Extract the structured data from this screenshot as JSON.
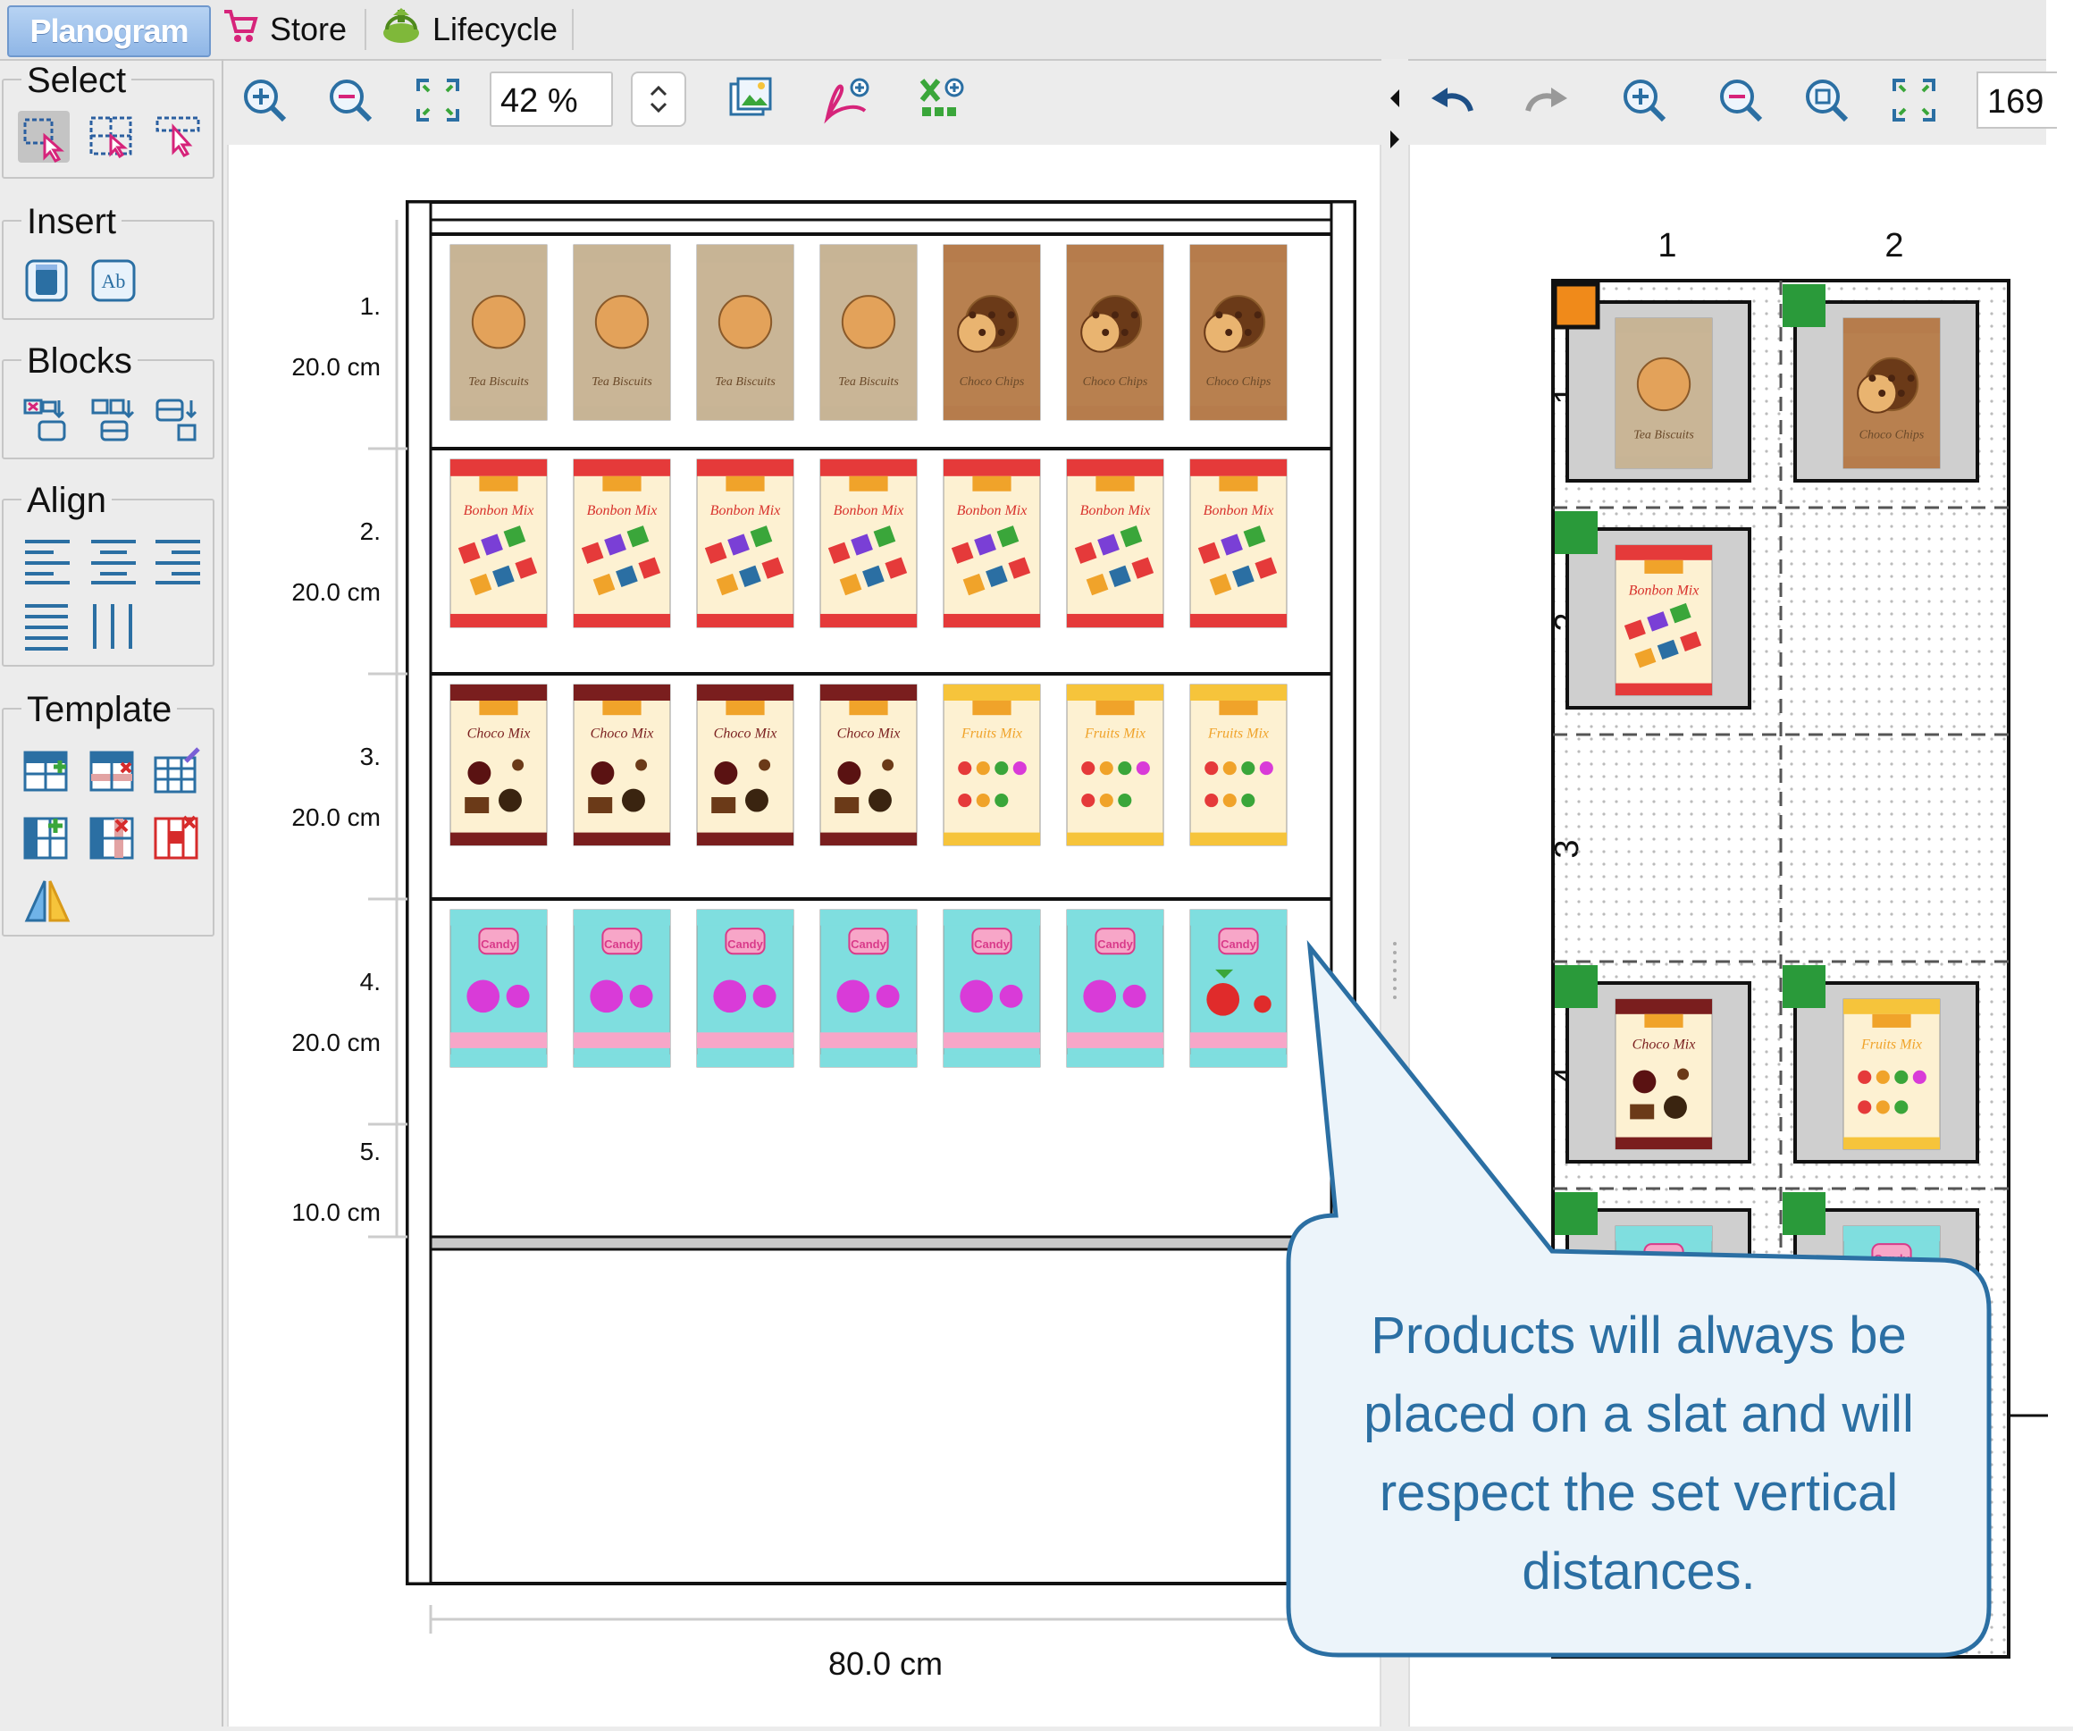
{
  "tabs": [
    {
      "label": "Planogram",
      "active": true
    },
    {
      "label": "Store",
      "icon": "cart-icon",
      "active": false
    },
    {
      "label": "Lifecycle",
      "icon": "lifecycle-icon",
      "active": false
    }
  ],
  "palette": {
    "select_title": "Select",
    "insert_title": "Insert",
    "blocks_title": "Blocks",
    "align_title": "Align",
    "template_title": "Template",
    "insert_text_glyph": "Ab"
  },
  "toolbar": {
    "zoom_value": "42 %",
    "right_zoom_value": "169"
  },
  "planogram": {
    "shelves": [
      {
        "number": "1.",
        "height": "20.0 cm"
      },
      {
        "number": "2.",
        "height": "20.0 cm"
      },
      {
        "number": "3.",
        "height": "20.0 cm"
      },
      {
        "number": "4.",
        "height": "20.0 cm"
      },
      {
        "number": "5.",
        "height": "10.0 cm"
      }
    ],
    "width_label": "80.0 cm",
    "rows": [
      [
        "tea-biscuit",
        "tea-biscuit",
        "tea-biscuit",
        "tea-biscuit",
        "choco-chips",
        "choco-chips",
        "choco-chips"
      ],
      [
        "bonbon-mix",
        "bonbon-mix",
        "bonbon-mix",
        "bonbon-mix",
        "bonbon-mix",
        "bonbon-mix",
        "bonbon-mix"
      ],
      [
        "choco-mix",
        "choco-mix",
        "choco-mix",
        "choco-mix",
        "fruits-mix",
        "fruits-mix",
        "fruits-mix"
      ],
      [
        "lolly-candy",
        "lolly-candy",
        "lolly-candy",
        "lolly-candy",
        "lolly-candy",
        "lolly-candy",
        "strawberry-candy"
      ]
    ]
  },
  "grid": {
    "column_labels": [
      "1",
      "2"
    ],
    "row_labels": [
      "1",
      "2",
      "3",
      "4"
    ]
  },
  "products": {
    "tea-biscuit": {
      "label": "Tea Biscuits",
      "top": "#b9a98d",
      "body": "#c9b596",
      "accent": "#e3a25a"
    },
    "choco-chips": {
      "label": "Choco Chips",
      "top": "#9e6138",
      "body": "#b8804f",
      "accent": "#6b3a18"
    },
    "bonbon-mix": {
      "label": "Bonbon Mix",
      "top": "#e53a3a",
      "body": "#fdf1d2",
      "accent": "#d8322c"
    },
    "choco-mix": {
      "label": "Choco Mix",
      "top": "#7a1e1e",
      "body": "#fdf1d2",
      "accent": "#7a1e1e"
    },
    "fruits-mix": {
      "label": "Fruits Mix",
      "top": "#f6c43b",
      "body": "#fdf1d2",
      "accent": "#f0a32a"
    },
    "lolly-candy": {
      "label": "Candy",
      "top": "#7fdedf",
      "body": "#7fdedf",
      "accent": "#d93bd8"
    },
    "strawberry-candy": {
      "label": "Candy",
      "top": "#7fdedf",
      "body": "#7fdedf",
      "accent": "#e02b2b"
    }
  },
  "callout": {
    "lines": [
      "Products will always be",
      "placed on a slat and will",
      "respect the set vertical",
      "distances."
    ]
  }
}
